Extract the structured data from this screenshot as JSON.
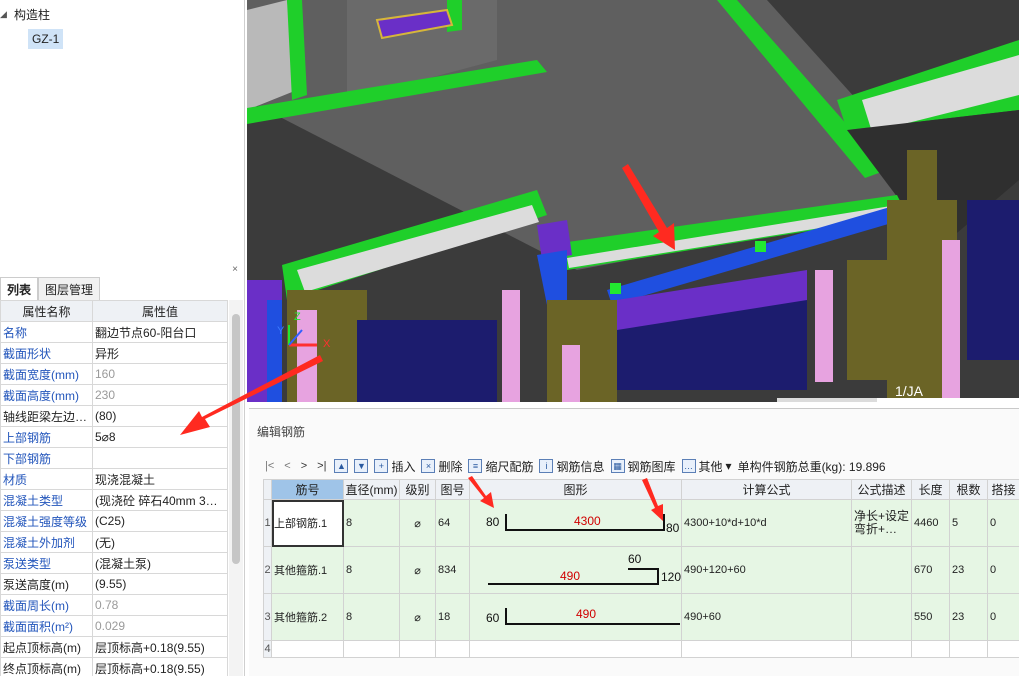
{
  "tree": {
    "parent_label": "构造柱",
    "child_label": "GZ-1"
  },
  "property_panel": {
    "close_symbol": "×",
    "tabs": [
      "列表",
      "图层管理"
    ],
    "columns": [
      "属性名称",
      "属性值"
    ],
    "rows": [
      {
        "name": "名称",
        "value": "翻边节点60-阳台口"
      },
      {
        "name": "截面形状",
        "value": "异形"
      },
      {
        "name": "截面宽度(mm)",
        "value": "160"
      },
      {
        "name": "截面高度(mm)",
        "value": "230"
      },
      {
        "name": "轴线距梁左边…",
        "value": "(80)"
      },
      {
        "name": "上部钢筋",
        "value": "5⌀8"
      },
      {
        "name": "下部钢筋",
        "value": ""
      },
      {
        "name": "材质",
        "value": "现浇混凝土"
      },
      {
        "name": "混凝土类型",
        "value": "(现浇砼 碎石40mm 3…"
      },
      {
        "name": "混凝土强度等级",
        "value": "(C25)"
      },
      {
        "name": "混凝土外加剂",
        "value": "(无)"
      },
      {
        "name": "泵送类型",
        "value": "(混凝土泵)"
      },
      {
        "name": "泵送高度(m)",
        "value": "(9.55)"
      },
      {
        "name": "截面周长(m)",
        "value": "0.78"
      },
      {
        "name": "截面面积(m²)",
        "value": "0.029"
      },
      {
        "name": "起点顶标高(m)",
        "value": "层顶标高+0.18(9.55)"
      },
      {
        "name": "终点顶标高(m)",
        "value": "层顶标高+0.18(9.55)"
      }
    ]
  },
  "viewport": {
    "axis_label_x": "X",
    "axis_label_y": "Y",
    "axis_label_z": "Z",
    "grid_label": "1/JA"
  },
  "rebar_editor": {
    "title": "编辑钢筋",
    "nav": [
      "|<",
      "<",
      ">",
      ">|"
    ],
    "toolbar": {
      "insert": "插入",
      "delete": "删除",
      "scale": "缩尺配筋",
      "info": "钢筋信息",
      "library": "钢筋图库",
      "other": "其他",
      "total_weight": "单构件钢筋总重(kg): 19.896"
    },
    "columns": [
      "筋号",
      "直径(mm)",
      "级别",
      "图号",
      "图形",
      "计算公式",
      "公式描述",
      "长度",
      "根数",
      "搭接"
    ],
    "rows": [
      {
        "index": "1",
        "name": "上部钢筋.1",
        "diameter": "8",
        "grade": "⌀",
        "fig_no": "64",
        "shape": {
          "left": "80",
          "mid": "4300",
          "right": "80"
        },
        "formula": "4300+10*d+10*d",
        "desc": "净长+设定弯折+…",
        "length": "4460",
        "count": "5",
        "lap": "0"
      },
      {
        "index": "2",
        "name": "其他箍筋.1",
        "diameter": "8",
        "grade": "⌀",
        "fig_no": "834",
        "shape": {
          "top": "60",
          "mid": "490",
          "right": "120"
        },
        "formula": "490+120+60",
        "desc": "",
        "length": "670",
        "count": "23",
        "lap": "0"
      },
      {
        "index": "3",
        "name": "其他箍筋.2",
        "diameter": "8",
        "grade": "⌀",
        "fig_no": "18",
        "shape": {
          "left": "60",
          "mid": "490"
        },
        "formula": "490+60",
        "desc": "",
        "length": "550",
        "count": "23",
        "lap": "0"
      },
      {
        "index": "4"
      }
    ]
  },
  "colors": {
    "slab_gray": "#5f5f5f",
    "beam_green": "#1fcf2a",
    "column_olive": "#6b6426",
    "wall_purple": "#6a2fc7",
    "highlight_blue": "#1f4fe0",
    "pink": "#e7a3e0",
    "arrow_red": "#ff2a20",
    "row_green": "#e6f6e4"
  }
}
